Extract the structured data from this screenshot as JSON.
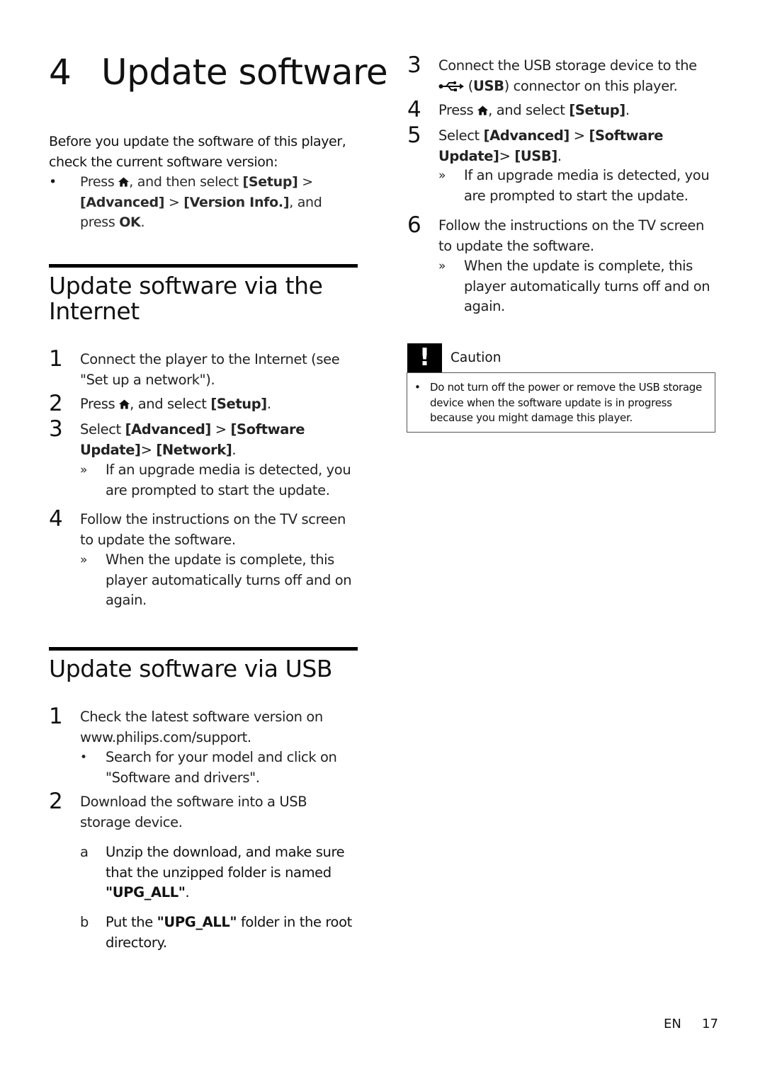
{
  "chapter": {
    "number": "4",
    "title": "Update software"
  },
  "intro": {
    "text": "Before you update the software of this player, check the current software version:",
    "bullet": {
      "mark": "•",
      "press": "Press ",
      "icon": "home-icon",
      "after_icon": ", and then select ",
      "setup": "[Setup]",
      "sep1": " > ",
      "advanced": "[Advanced]",
      "sep2": " > ",
      "version_info": "[Version Info.]",
      "and_press": ", and press ",
      "ok": "OK",
      "end": "."
    }
  },
  "section_internet": {
    "title": "Update software via the Internet",
    "steps": [
      {
        "number": "1",
        "text": "Connect the player to the Internet (see \"Set up a network\")."
      },
      {
        "number": "2",
        "pre": "Press ",
        "icon": "home-icon",
        "mid": ", and select ",
        "menu": "[Setup]",
        "end": "."
      },
      {
        "number": "3",
        "pre": "Select ",
        "menu1": "[Advanced]",
        "sep": " > ",
        "menu2": "[Software Update]",
        "sep2": "> ",
        "menu3": "[Network]",
        "end": ".",
        "result": {
          "mark": "»",
          "text": "If an upgrade media is detected, you are prompted to start the update."
        }
      },
      {
        "number": "4",
        "text": "Follow the instructions on the TV screen to update the software.",
        "result": {
          "mark": "»",
          "text": "When the update is complete, this player automatically turns off and on again."
        }
      }
    ]
  },
  "section_usb": {
    "title": "Update software via USB",
    "steps": [
      {
        "number": "1",
        "text": "Check the latest software version on www.philips.com/support.",
        "bullet": {
          "mark": "•",
          "text": "Search for your model and click on \"Software and drivers\"."
        }
      },
      {
        "number": "2",
        "text": "Download the software into a USB storage device.",
        "substeps": [
          {
            "mark": "a",
            "pre": "Unzip the download, and make sure that the unzipped folder is named ",
            "bold": "\"UPG_ALL\"",
            "end": "."
          },
          {
            "mark": "b",
            "pre": "Put the ",
            "bold": "\"UPG_ALL\"",
            "end": " folder in the root directory."
          }
        ]
      },
      {
        "number": "3",
        "pre": "Connect the USB storage device to the ",
        "icon": "usb-icon",
        "paren_open": " (",
        "usb": "USB",
        "paren_close": ") connector on this player."
      },
      {
        "number": "4",
        "pre": "Press ",
        "icon": "home-icon",
        "mid": ", and select ",
        "menu": "[Setup]",
        "end": "."
      },
      {
        "number": "5",
        "pre": "Select ",
        "menu1": "[Advanced]",
        "sep": " > ",
        "menu2": "[Software Update]",
        "sep2": "> ",
        "menu3": "[USB]",
        "end": ".",
        "result": {
          "mark": "»",
          "text": "If an upgrade media is detected, you are prompted to start the update."
        }
      },
      {
        "number": "6",
        "text": "Follow the instructions on the TV screen to update the software.",
        "result": {
          "mark": "»",
          "text": "When the update is complete, this player automatically turns off and on again."
        }
      }
    ]
  },
  "caution": {
    "icon": "exclamation-icon",
    "bang": "!",
    "title": "Caution",
    "bullet": "•",
    "text": "Do not turn off the power or remove the USB storage device when the software update is in progress because you might damage this player."
  },
  "footer": {
    "language": "EN",
    "page": "17"
  }
}
